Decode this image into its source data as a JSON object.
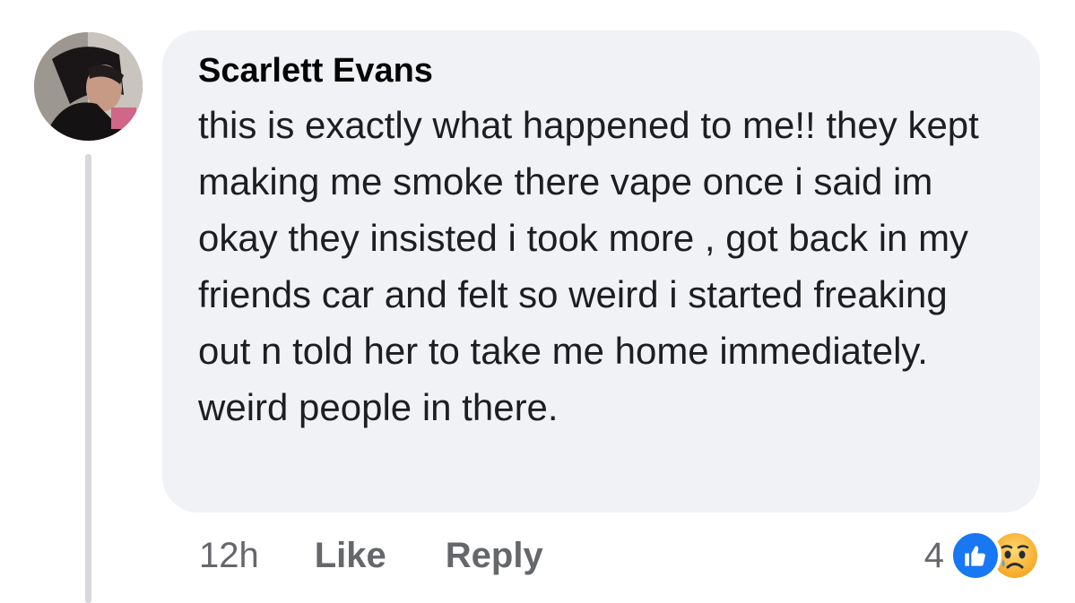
{
  "comment": {
    "author": "Scarlett Evans",
    "text": "this is exactly what happened to me!! they kept making me smoke there vape once i said im okay they insisted i took more , got back in my friends car and felt so weird i started freaking out n told her to take me home immediately. weird people in there.",
    "timestamp": "12h",
    "like_label": "Like",
    "reply_label": "Reply",
    "reaction_count": "4",
    "reactions": [
      "like-icon",
      "sad-icon"
    ]
  },
  "colors": {
    "bubble": "#f0f2f5",
    "secondary_text": "#65676b",
    "like_blue": "#1877f2",
    "sad_yellow": "#f7b125"
  }
}
